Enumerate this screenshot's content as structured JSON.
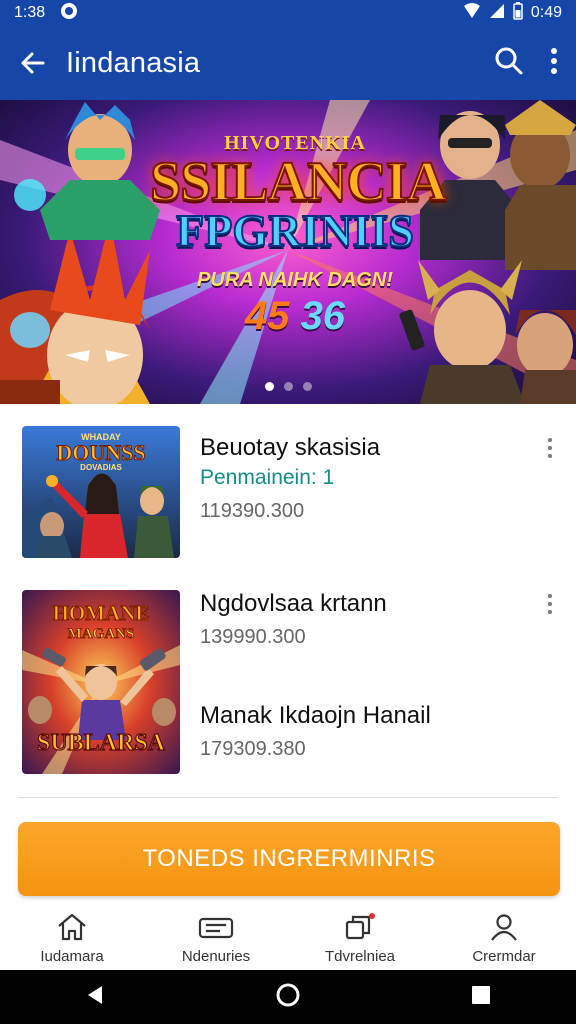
{
  "status_bar": {
    "time_left": "1:38",
    "time_right": "0:49"
  },
  "app_bar": {
    "title": "Iindanasia"
  },
  "banner": {
    "kicker": "HIVOTENKIA",
    "title": "SSILANCIA",
    "subtitle": "FPGRINIIS",
    "tagline": "PURA NAIHK DAGN!",
    "number_a": "45",
    "number_b": "36",
    "dots_count": 3,
    "active_dot": 1
  },
  "items": [
    {
      "thumb_text_top": "WHADAY",
      "thumb_text_main": "DOUNSS",
      "thumb_text_sub": "DOVADIAS",
      "title": "Beuotay skasisia",
      "subtitle": "Penmainein: 1",
      "number": "119390.300"
    },
    {
      "thumb_text_top": "HOMANE",
      "thumb_text_main": "MAGANS",
      "thumb_text_sub": "SUBLARSA",
      "title": "Ngdovlsaa krtann",
      "number": "139990.300",
      "title2": "Manak Ikdaojn Hanail",
      "number2": "179309.380"
    }
  ],
  "cta": {
    "label": "TONEDS INGRERMINRIS"
  },
  "bottom_nav": [
    {
      "icon": "home-icon",
      "label": "Iudamara"
    },
    {
      "icon": "ticket-icon",
      "label": "Ndenuries"
    },
    {
      "icon": "layers-icon",
      "label": "Tdvrelniea"
    },
    {
      "icon": "person-icon",
      "label": "Crermdar"
    }
  ],
  "colors": {
    "app_bar": "#1646a8",
    "cta": "#f59a1c",
    "accent_text": "#178c88"
  }
}
